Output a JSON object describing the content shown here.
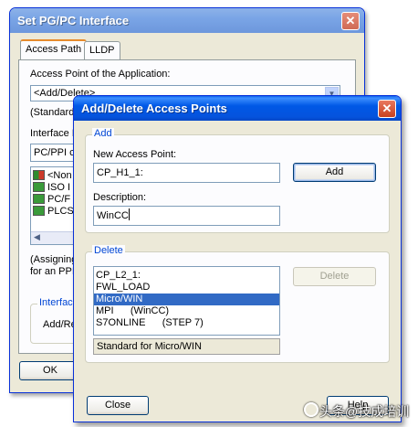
{
  "outer_window": {
    "title": "Set PG/PC Interface",
    "tabs": [
      {
        "label": "Access Path"
      },
      {
        "label": "LLDP"
      }
    ],
    "access_point_label": "Access Point of the Application:",
    "access_point_value": "<Add/Delete>",
    "access_point_note": "(Standard",
    "interface_label": "Interface P",
    "interface_value": "PC/PPI c",
    "interface_items": [
      "<Non",
      "ISO I",
      "PC/F",
      "PLCS"
    ],
    "assigning_text_1": "(Assigning",
    "assigning_text_2": "for an PPI",
    "interfaces_group_label": "Interface",
    "add_remove_label": "Add/Re",
    "ok_label": "OK"
  },
  "inner_window": {
    "title": "Add/Delete Access Points",
    "add_group": {
      "caption": "Add",
      "new_access_point_label": "New Access Point:",
      "new_access_point_value": "CP_H1_1:",
      "add_button": "Add",
      "description_label": "Description:",
      "description_value": "WinCC"
    },
    "delete_group": {
      "caption": "Delete",
      "items": [
        {
          "text": "CP_L2_1:"
        },
        {
          "text": "FWL_LOAD"
        },
        {
          "text": "Micro/WIN",
          "selected": true
        },
        {
          "text": "MPI      (WinCC)"
        },
        {
          "text": "S7ONLINE      (STEP 7)"
        }
      ],
      "delete_button": "Delete",
      "status_text": "Standard for Micro/WIN"
    },
    "close_button": "Close",
    "help_button": "Help"
  },
  "watermark": "头条@技成培训"
}
